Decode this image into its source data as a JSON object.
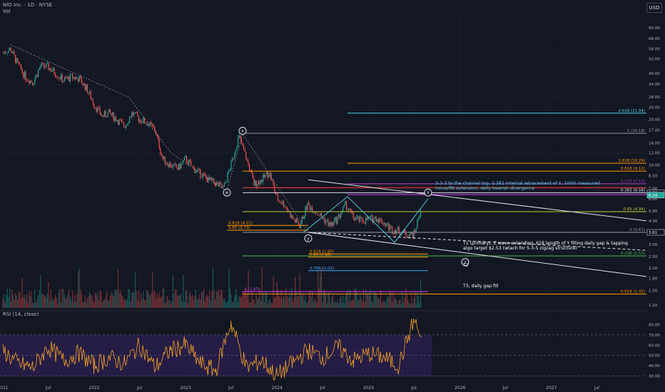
{
  "header": {
    "symbol_line": "NIO Inc. · 1D · NYSE",
    "vol_label": "Vol",
    "currency_button": "USD",
    "rsi_label": "RSI (14, close)"
  },
  "colors": {
    "background": "#131722",
    "grid": "#1f2330",
    "candle_up": "#26a69a",
    "candle_down": "#ef5350",
    "rsi_line": "#f0a22c",
    "rsi_band": "#2a1f4d",
    "trendline": "#e0e3eb",
    "zigzag": "#4fc3d8"
  },
  "chart_data": [
    {
      "type": "line",
      "title": "",
      "scale": "log",
      "y_ticks": [
        "80.00",
        "68.00",
        "58.00",
        "50.00",
        "40.00",
        "34.00",
        "28.00",
        "24.00",
        "20.00",
        "17.00",
        "14.00",
        "12.00",
        "10.00",
        "8.50",
        "7.00",
        "6.00",
        "5.00",
        "4.30",
        "3.61",
        "3.00",
        "2.50",
        "2.10",
        "1.80",
        "1.50",
        "1.20"
      ],
      "x_ticks": [
        "2021",
        "Jul",
        "2022",
        "Jul",
        "2023",
        "Jul",
        "2024",
        "Jul",
        "2025",
        "Jul",
        "2026",
        "Jul",
        "2027",
        "Jul"
      ],
      "ylim": [
        1.15,
        90
      ],
      "series": [
        {
          "name": "",
          "x": [
            "2021-01",
            "2021-02",
            "2021-03",
            "2021-04",
            "2021-05",
            "2021-06",
            "2021-07",
            "2021-08",
            "2021-09",
            "2021-10",
            "2021-11",
            "2021-12",
            "2022-01",
            "2022-02",
            "2022-03",
            "2022-04",
            "2022-05",
            "2022-06",
            "2022-07",
            "2022-08",
            "2022-09",
            "2022-10",
            "2022-11",
            "2022-12",
            "2023-01",
            "2023-02",
            "2023-03",
            "2023-04",
            "2023-05",
            "2023-06",
            "2023-07",
            "2023-08",
            "2023-09",
            "2023-10",
            "2023-11",
            "2023-12",
            "2024-01",
            "2024-02",
            "2024-03",
            "2024-04",
            "2024-05",
            "2024-06",
            "2024-07",
            "2024-08",
            "2024-09",
            "2024-10",
            "2024-11",
            "2024-12",
            "2025-01",
            "2025-02",
            "2025-03",
            "2025-04",
            "2025-05",
            "2025-06",
            "2025-07",
            "2025-08"
          ],
          "values": [
            55,
            58,
            46,
            38,
            35,
            45,
            44,
            40,
            36,
            38,
            37,
            32,
            25,
            21,
            22,
            20,
            18,
            22,
            20,
            19,
            17,
            11,
            10,
            9.5,
            11,
            9.5,
            8.8,
            8,
            7.6,
            7.0,
            10,
            15.5,
            11,
            7.5,
            8,
            9,
            6,
            5.5,
            4.5,
            4,
            5.5,
            5,
            4.5,
            4,
            4.5,
            5.5,
            4.5,
            4.3,
            4.4,
            4.5,
            4.2,
            3.8,
            3.7,
            3.5,
            3.5,
            5.4
          ]
        }
      ],
      "last_price_label": "6.34",
      "current_level_label": "6.58",
      "pivot_label": "3.61",
      "wave_labels": [
        "W",
        "X",
        "Y",
        "X",
        "Z"
      ],
      "fib_levels": [
        {
          "label": "2.618 (21.94)",
          "value": 21.94,
          "color": "#4dd0e1"
        },
        {
          "label": "1 (16.18)",
          "value": 16.18,
          "color": "#9598a1"
        },
        {
          "label": "1.618 (10.29)",
          "value": 10.29,
          "color": "#ff9800"
        },
        {
          "label": "0.618 (9.12)",
          "value": 9.12,
          "color": "#ff9800"
        },
        {
          "label": "1.272 (7.53)",
          "value": 7.53,
          "color": "#ab47bc"
        },
        {
          "label": "0.382 (6.58)",
          "value": 6.58,
          "color": "#e0e3eb"
        },
        {
          "label": "0.65 (4.94)",
          "value": 4.94,
          "color": "#c0ca33"
        },
        {
          "label": "0 (3.61)",
          "value": 3.61,
          "color": "#9598a1"
        },
        {
          "label": "0.236 (2.53)",
          "value": 2.53,
          "color": "#4caf50"
        },
        {
          "label": "0.786 (2.02)",
          "value": 2.02,
          "color": "#42a5f5"
        },
        {
          "label": "1 (1.47)",
          "value": 1.47,
          "color": "#e040fb"
        },
        {
          "label": "0.618 (1.42)",
          "value": 1.42,
          "color": "#ff9800"
        },
        {
          "label": "0.618 (4.01)",
          "value": 4.01,
          "color": "#ff9800"
        },
        {
          "label": "0.65 (3.73)",
          "value": 3.73,
          "color": "#ff9800"
        },
        {
          "label": "0.618 (2.60)",
          "value": 2.6,
          "color": "#ff9800"
        },
        {
          "label": "0.65 (2.48)",
          "value": 2.48,
          "color": "#ff9800"
        }
      ],
      "annotations": [
        {
          "text": "3-3-3 to the channel top, 0.382 internal retracement of Y, 100% measured",
          "color": "#4dd0e1"
        },
        {
          "text": "move/fib extension, daily bearish divergence",
          "color": "#4dd0e1"
        },
        {
          "text": "T1 (primary), Z wave extending .618 length of Y filling daily gap & tapping",
          "color": "#ffffff"
        },
        {
          "text": "algo target $2.53 (wtach for 5-3-5 zigzag structure)",
          "color": "#ffffff"
        },
        {
          "text": "T2",
          "color": "#ffffff"
        },
        {
          "text": "T3, daily gap fill",
          "color": "#ffffff"
        }
      ]
    },
    {
      "type": "line",
      "title": "",
      "y_ticks": [
        "80.00",
        "70.00",
        "60.00",
        "50.00",
        "40.00",
        "30.00"
      ],
      "ylim": [
        24,
        88
      ],
      "series": [
        {
          "name": "",
          "x": [
            "2021-01",
            "2021-03",
            "2021-05",
            "2021-07",
            "2021-09",
            "2021-11",
            "2022-01",
            "2022-03",
            "2022-05",
            "2022-07",
            "2022-09",
            "2022-11",
            "2023-01",
            "2023-03",
            "2023-05",
            "2023-07",
            "2023-09",
            "2023-11",
            "2024-01",
            "2024-03",
            "2024-05",
            "2024-07",
            "2024-09",
            "2024-11",
            "2025-01",
            "2025-03",
            "2025-05",
            "2025-07",
            "2025-08"
          ],
          "values": [
            55,
            42,
            38,
            58,
            45,
            52,
            40,
            48,
            42,
            60,
            38,
            55,
            60,
            42,
            35,
            82,
            38,
            45,
            30,
            42,
            55,
            48,
            58,
            45,
            52,
            48,
            40,
            85,
            65
          ]
        }
      ]
    }
  ]
}
